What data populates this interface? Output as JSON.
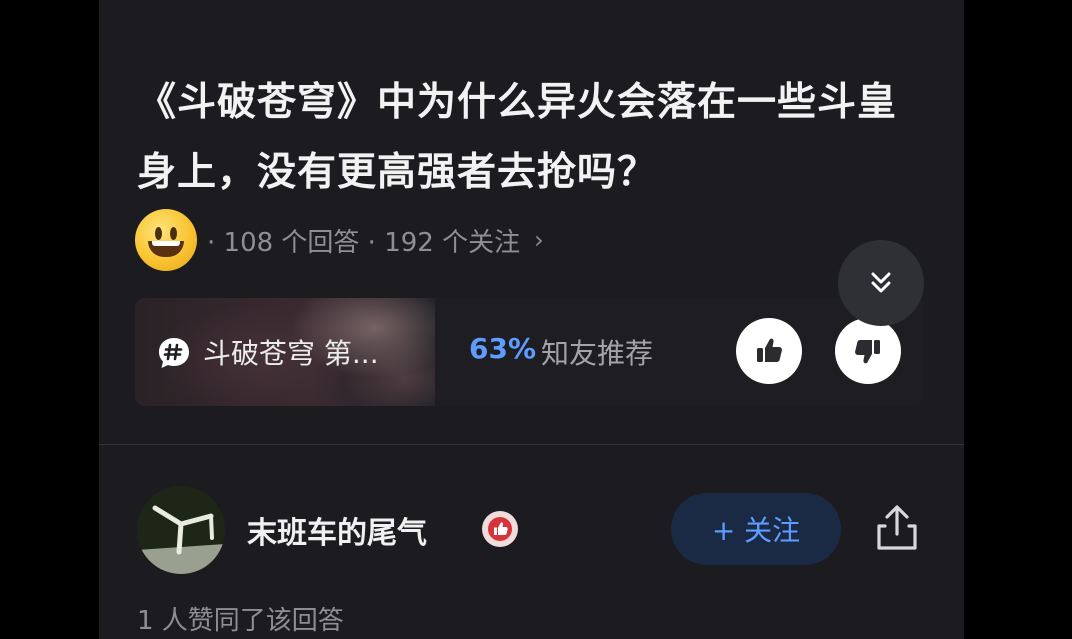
{
  "question": {
    "title": "《斗破苍穹》中为什么异火会落在一些斗皇身上，没有更高强者去抢吗？",
    "meta": "· 108 个回答 · 192 个关注",
    "meta_chevron": "›",
    "avatar_icon": "smiley-face-icon"
  },
  "recommend_card": {
    "topic_icon": "hashtag-bubble-icon",
    "topic_label": "斗破苍穹 第...",
    "percent": "63%",
    "label": "知友推荐"
  },
  "colors": {
    "accent": "#5e9cff",
    "background": "#1c1c20",
    "muted_text": "#8e8e94"
  },
  "answer": {
    "author_name": "末班车的尾气",
    "follow_label": "+ 关注",
    "endorse_text": "1 人赞同了该回答"
  }
}
